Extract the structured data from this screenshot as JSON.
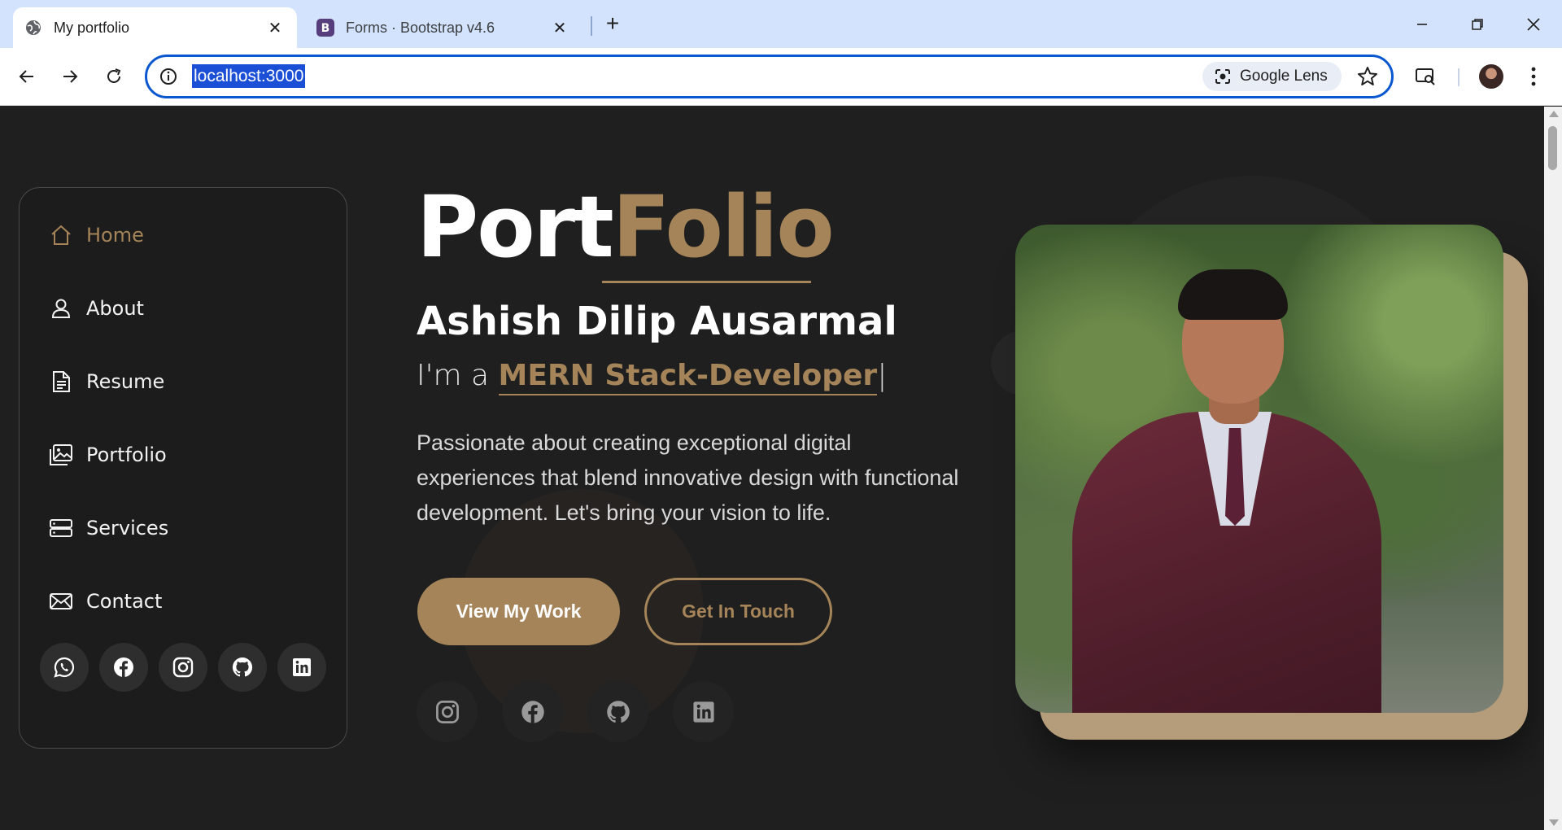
{
  "browser": {
    "tabs": [
      {
        "title": "My portfolio",
        "favicon": "globe-icon",
        "active": true
      },
      {
        "title": "Forms · Bootstrap v4.6",
        "favicon": "bootstrap-icon",
        "active": false
      }
    ],
    "url": "localhost:3000",
    "lens_label": "Google Lens"
  },
  "sidebar": {
    "items": [
      {
        "label": "Home",
        "icon": "home-icon",
        "active": true
      },
      {
        "label": "About",
        "icon": "person-icon"
      },
      {
        "label": "Resume",
        "icon": "document-icon"
      },
      {
        "label": "Portfolio",
        "icon": "images-icon"
      },
      {
        "label": "Services",
        "icon": "server-icon"
      },
      {
        "label": "Contact",
        "icon": "envelope-icon"
      }
    ],
    "social": [
      "whatsapp-icon",
      "facebook-icon",
      "instagram-icon",
      "github-icon",
      "linkedin-icon"
    ]
  },
  "hero": {
    "title_main": "Port",
    "title_accent": "Folio",
    "name": "Ashish Dilip Ausarmal",
    "role_prefix": "I'm a ",
    "role_highlight": "MERN Stack-Developer",
    "role_caret": "|",
    "description": "Passionate about creating exceptional digital experiences that blend innovative design with functional development. Let's bring your vision to life.",
    "primary_button": "View My Work",
    "secondary_button": "Get In Touch",
    "social": [
      "instagram-icon",
      "facebook-icon",
      "github-icon",
      "linkedin-icon"
    ]
  },
  "colors": {
    "accent": "#a48458",
    "background": "#1f1f1f",
    "photo_frame": "#b59d7b"
  }
}
